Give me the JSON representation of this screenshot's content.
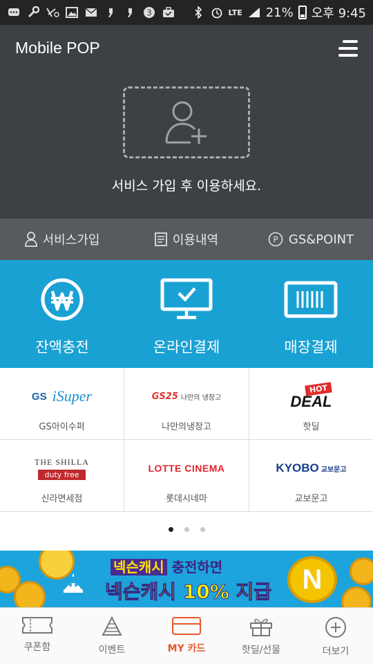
{
  "status_bar": {
    "network": "LTE",
    "battery": "21%",
    "time": "오후 9:45"
  },
  "header": {
    "title": "Mobile POP",
    "message": "서비스 가입 후 이용하세요."
  },
  "service_links": [
    {
      "label": "서비스가입",
      "icon": "person-icon"
    },
    {
      "label": "이용내역",
      "icon": "document-icon"
    },
    {
      "label": "GS&POINT",
      "icon": "point-icon"
    }
  ],
  "pay_actions": [
    {
      "label": "잔액충전",
      "icon": "won-icon"
    },
    {
      "label": "온라인결제",
      "icon": "monitor-check-icon"
    },
    {
      "label": "매장결제",
      "icon": "barcode-icon"
    }
  ],
  "partners": [
    {
      "name": "GS아이수퍼",
      "logo_a": "GS",
      "logo_b": "iSuper"
    },
    {
      "name": "나만의냉장고",
      "logo_a": "GS25",
      "logo_b": "나만의 냉장고"
    },
    {
      "name": "핫딜",
      "logo_a": "HOT",
      "logo_b": "DEAL"
    },
    {
      "name": "신라면세점",
      "logo_a": "THE SHILLA",
      "logo_b": "duty free"
    },
    {
      "name": "롯데시네마",
      "logo_a": "LOTTE CINEMA",
      "logo_b": ""
    },
    {
      "name": "교보문고",
      "logo_a": "KYOBO",
      "logo_b": "교보문고"
    }
  ],
  "pagination": {
    "current": 1,
    "total": 3
  },
  "banner": {
    "line1_brand": "넥슨캐시",
    "line1_rest": " 충전하면",
    "line2": "넥슨캐시 10% 지급",
    "coin_letter": "N"
  },
  "bottom_nav": [
    {
      "label": "쿠폰함",
      "icon": "ticket-icon",
      "active": false
    },
    {
      "label": "이벤트",
      "icon": "party-hat-icon",
      "active": false
    },
    {
      "label": "MY 카드",
      "icon": "card-icon",
      "active": true
    },
    {
      "label": "핫딜/선물",
      "icon": "gift-icon",
      "active": false
    },
    {
      "label": "더보기",
      "icon": "plus-circle-icon",
      "active": false
    }
  ],
  "colors": {
    "header_bg": "#3d4044",
    "service_bg": "#575b60",
    "pay_bg": "#1aa1d3",
    "active_nav": "#e8572a"
  }
}
